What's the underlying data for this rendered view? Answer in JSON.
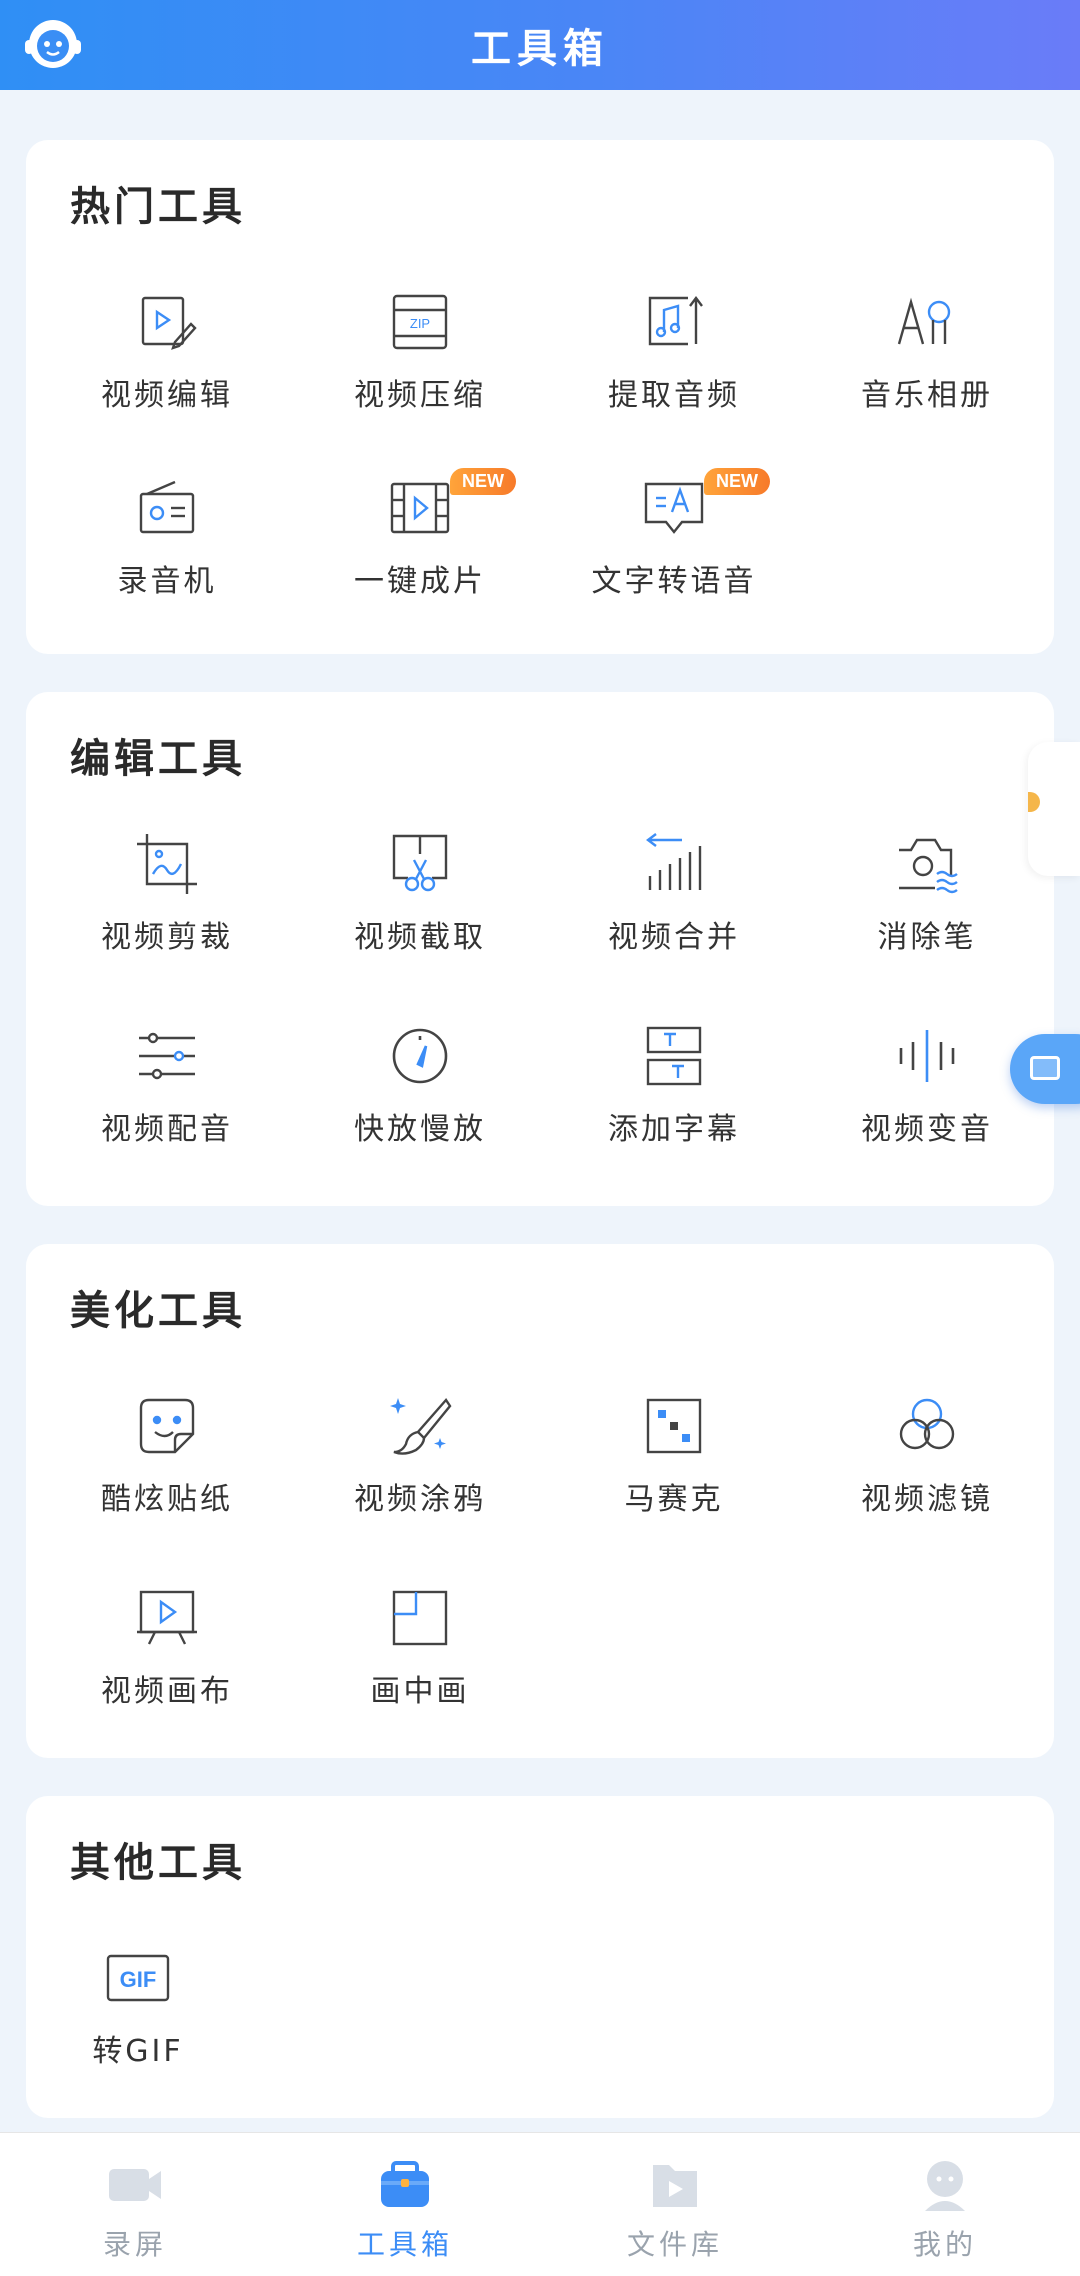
{
  "header": {
    "title": "工具箱"
  },
  "sections": [
    {
      "title": "热门工具",
      "tools": [
        {
          "label": "视频编辑",
          "icon": "video-edit-icon"
        },
        {
          "label": "视频压缩",
          "icon": "zip-icon"
        },
        {
          "label": "提取音频",
          "icon": "music-extract-icon"
        },
        {
          "label": "音乐相册",
          "icon": "music-album-icon"
        },
        {
          "label": "录音机",
          "icon": "radio-icon"
        },
        {
          "label": "一键成片",
          "icon": "film-icon",
          "badge": "NEW"
        },
        {
          "label": "文字转语音",
          "icon": "text-to-speech-icon",
          "badge": "NEW"
        }
      ]
    },
    {
      "title": "编辑工具",
      "tools": [
        {
          "label": "视频剪裁",
          "icon": "crop-icon"
        },
        {
          "label": "视频截取",
          "icon": "scissors-icon"
        },
        {
          "label": "视频合并",
          "icon": "merge-icon"
        },
        {
          "label": "消除笔",
          "icon": "eraser-camera-icon"
        },
        {
          "label": "视频配音",
          "icon": "sliders-icon"
        },
        {
          "label": "快放慢放",
          "icon": "speed-gauge-icon"
        },
        {
          "label": "添加字幕",
          "icon": "subtitle-icon"
        },
        {
          "label": "视频变音",
          "icon": "voice-wave-icon"
        }
      ]
    },
    {
      "title": "美化工具",
      "tools": [
        {
          "label": "酷炫贴纸",
          "icon": "sticker-icon"
        },
        {
          "label": "视频涂鸦",
          "icon": "brush-icon"
        },
        {
          "label": "马赛克",
          "icon": "mosaic-icon"
        },
        {
          "label": "视频滤镜",
          "icon": "filter-icon"
        },
        {
          "label": "视频画布",
          "icon": "canvas-icon"
        },
        {
          "label": "画中画",
          "icon": "picture-in-picture-icon"
        }
      ]
    },
    {
      "title": "其他工具",
      "tools": [
        {
          "label": "转GIF",
          "icon": "gif-icon"
        }
      ]
    }
  ],
  "tabbar": [
    {
      "label": "录屏",
      "icon": "record-camera-icon",
      "active": false
    },
    {
      "label": "工具箱",
      "icon": "toolbox-icon",
      "active": true
    },
    {
      "label": "文件库",
      "icon": "file-library-icon",
      "active": false
    },
    {
      "label": "我的",
      "icon": "profile-icon",
      "active": false
    }
  ],
  "colors": {
    "accent": "#3c8df6",
    "icon_stroke": "#444444",
    "badge": "#f7902f"
  }
}
